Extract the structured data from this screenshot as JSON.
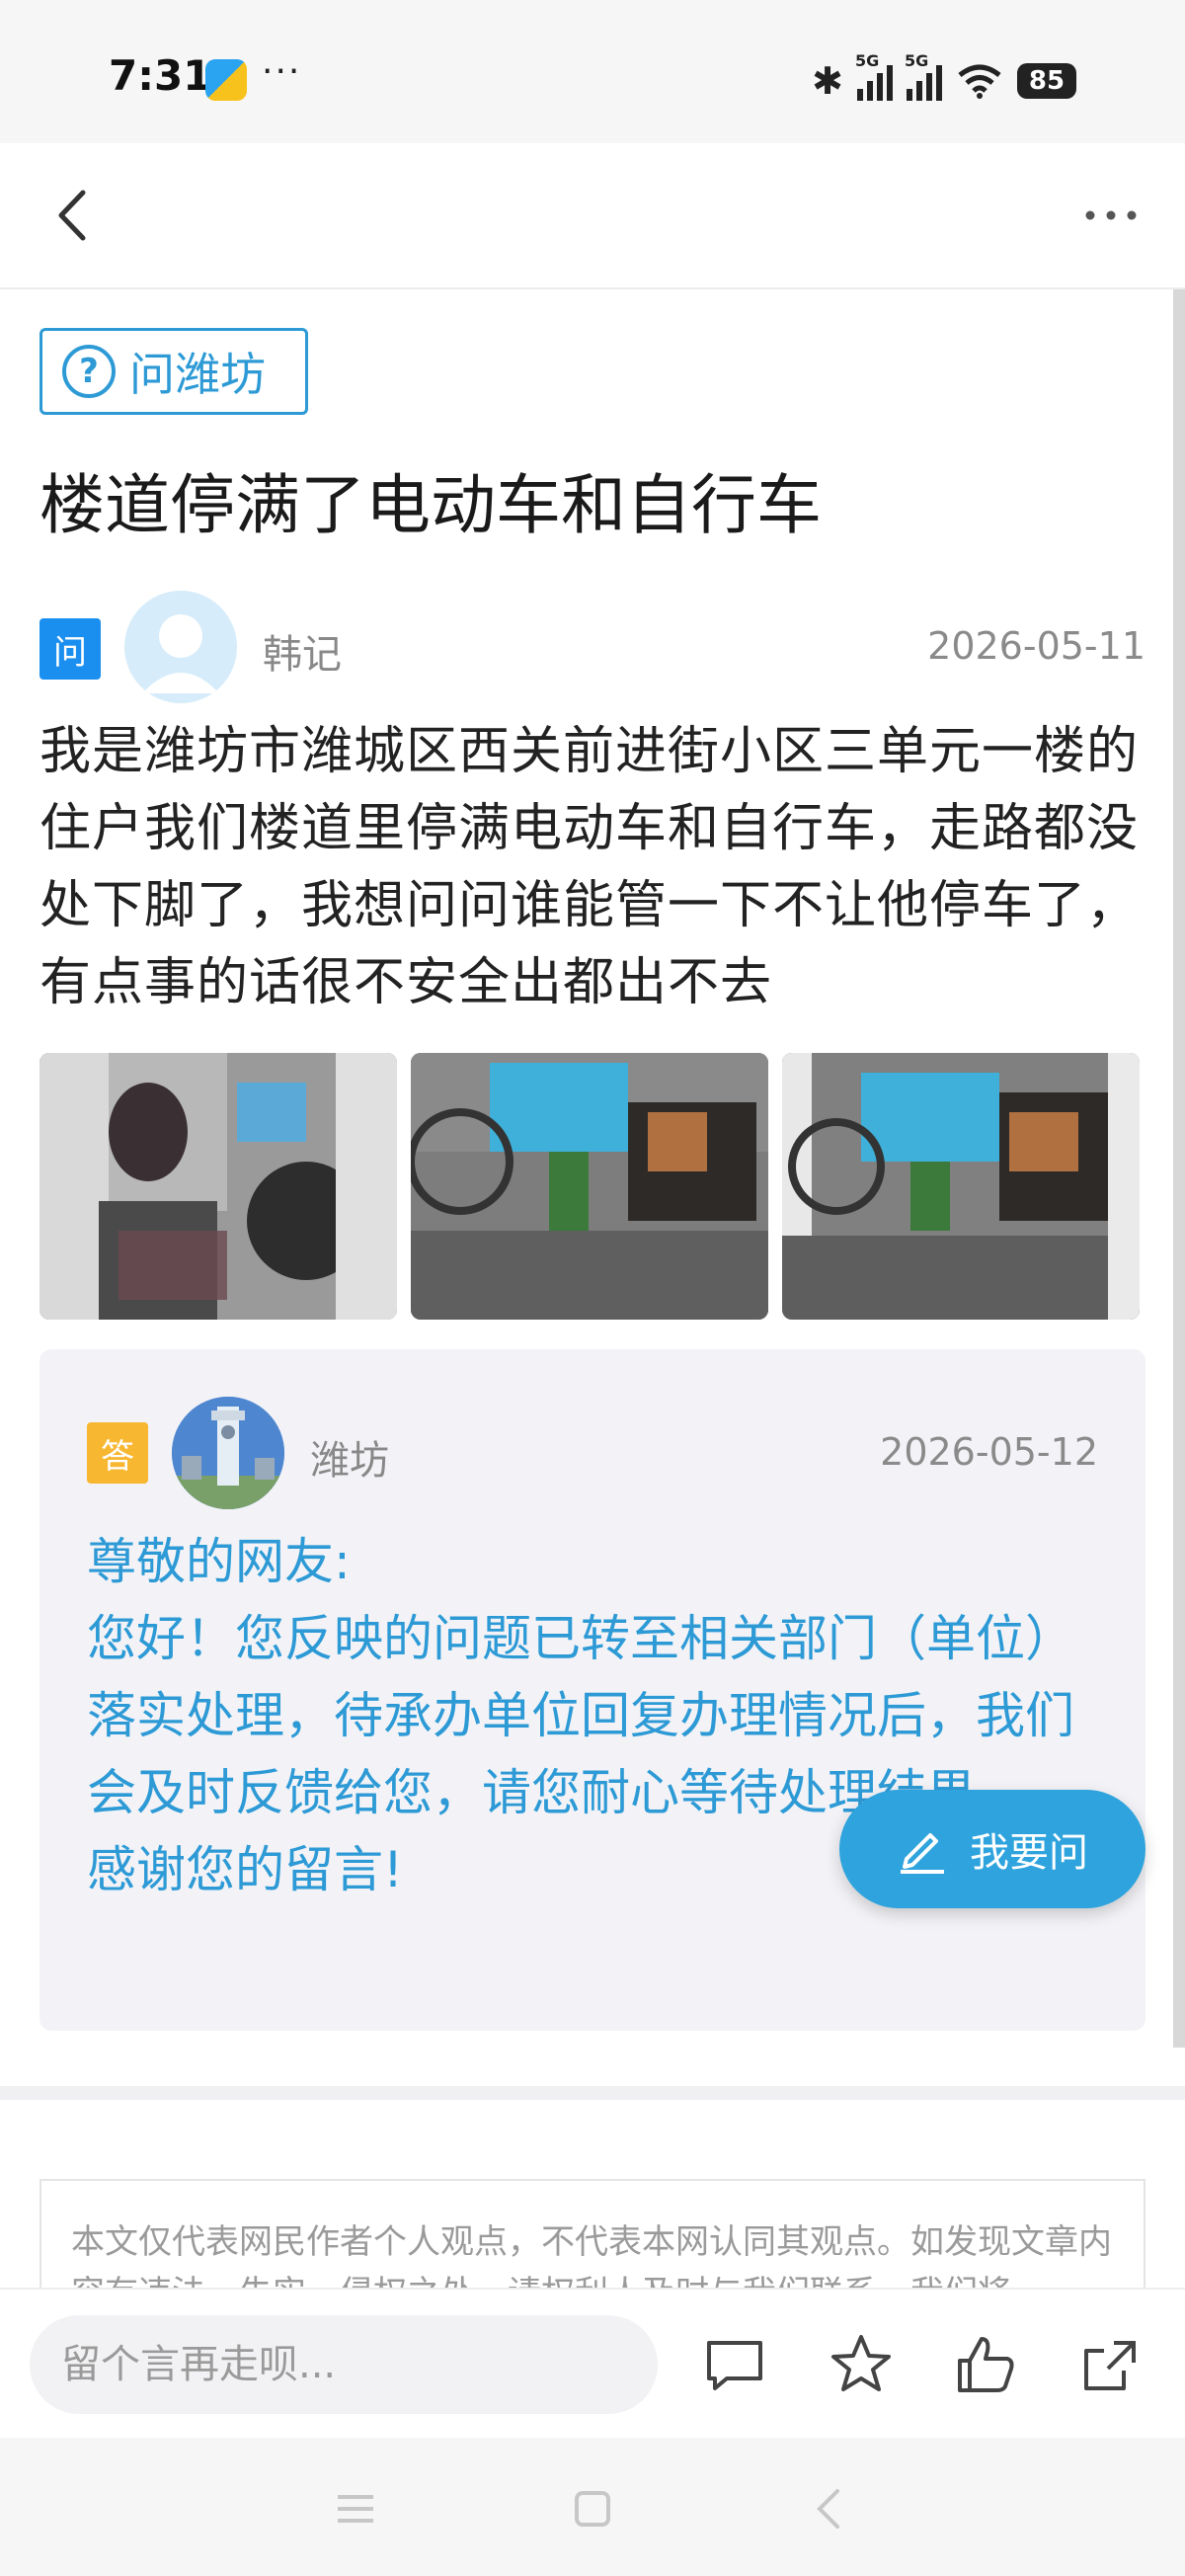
{
  "status_bar": {
    "time": "7:31",
    "dots": "···",
    "signal_1_label": "5G",
    "signal_2_label": "5G",
    "battery": "85"
  },
  "nav": {
    "back_icon": "back-chevron-icon",
    "more_icon": "more-dots-icon"
  },
  "post": {
    "tag_label": "问潍坊",
    "title": "楼道停满了电动车和自行车",
    "question": {
      "badge": "问",
      "author": "韩记",
      "date": "2026-05-11",
      "body": "我是潍坊市潍城区西关前进街小区三单元一楼的住户我们楼道里停满电动车和自行车，走路都没处下脚了，我想问问谁能管一下不让他停车了，有点事的话很不安全出都出不去"
    },
    "answer": {
      "badge": "答",
      "author": "潍坊",
      "date": "2026-05-12",
      "lines": [
        "尊敬的网友:",
        "您好！您反映的问题已转至相关部门（单位）落实处理，待承办单位回复办理情况后，我们会及时反馈给您，请您耐心等待处理结果。",
        "感谢您的留言!"
      ]
    }
  },
  "fab": {
    "label": "我要问",
    "icon": "edit-pencil-icon"
  },
  "disclaimer": "本文仅代表网民作者个人观点，不代表本网认同其观点。如发现文章内容有违法、失实、侵权之处，请权利人及时与我们联系，我们将",
  "bottom_bar": {
    "comment_placeholder": "留个言再走呗...",
    "icons": [
      "comment-icon",
      "star-icon",
      "thumbs-up-icon",
      "share-icon"
    ]
  },
  "colors": {
    "accent": "#2d9ad6",
    "question_badge": "#1a8ff0",
    "answer_badge": "#f7b731",
    "card_bg": "#f3f3f7"
  }
}
